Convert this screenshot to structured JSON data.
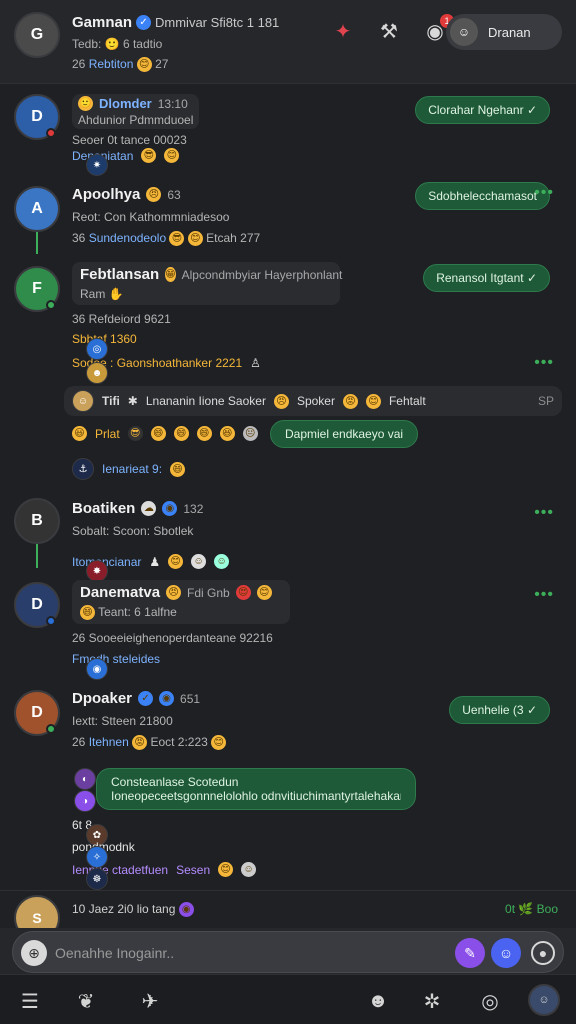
{
  "header": {
    "title": "Gamnan",
    "title_tail": "Dmmivar Sfi8tc 1 181",
    "sub": "Tedb: 🙂 6 tadtio",
    "line3_num": "26",
    "line3_link": "Rebtiton",
    "line3_tail": "27",
    "icons": [
      "fire-icon",
      "hammer-icon",
      "chat-icon"
    ],
    "badge": "1",
    "profile_label": "Dranan",
    "avatar_initials": "G"
  },
  "posts": [
    {
      "name": "Dlomder",
      "meta": "13:10",
      "line1": "Ahdunior Pdmmduoel",
      "line2": "Seoer 0t tance 00023",
      "reply_link": "Denaniatan",
      "pill": "Clorahar Ngehanr ✓",
      "initials": "D",
      "color": "#2c5fa8"
    },
    {
      "name": "Apoolhya",
      "meta": "63",
      "line1": "Reot: Con Kathommniadesoo",
      "line2_num": "36",
      "line2_link": "Sundenodeolo",
      "line2_tail": "Etcah 277",
      "pill": "Sdobhelecchamasot",
      "initials": "A",
      "color": "#3b76c4"
    },
    {
      "name": "Febtlansan",
      "meta": "Alpcondmbyiar Hayerphonlant",
      "line1": "Ram",
      "line2": "36 Refdeiord 9621",
      "reply1": "Sbbtaf 1360",
      "reply2": "Sodoe : Gaonshoathanker 2221",
      "pill": "Renansol Itgtant ✓",
      "initials": "F",
      "color": "#2f8c4a"
    },
    {
      "wide_name": "Tifi",
      "wide_mid": "Lnananin Iione Saoker",
      "wide_mid2": "Spoker",
      "wide_right": "Fehtalt",
      "wide_end": "SP",
      "prat": "Prlat",
      "green_bubble": "Dapmiel endkaeyo vai",
      "reply_link": "Ienarieat 9:"
    },
    {
      "name": "Boatiken",
      "meta": "132",
      "line1": "Sobalt: Scoon: Sbotlek",
      "reply_link": "Itomoncianar",
      "initials": "B",
      "color": "#444"
    },
    {
      "name": "Danematva",
      "meta": "Fdi Gnb",
      "line1": "Teant: 6 1alfne",
      "line2": "26 Sooeeieighenoperdanteane 92216",
      "reply_link": "Fmodh steleides",
      "initials": "D",
      "color": "#2a3e6b"
    },
    {
      "name": "Dpoaker",
      "meta": "651",
      "line1": "Iextt: Stteen 21800",
      "line2_num": "26",
      "line2_link": "Itehnen",
      "line2_tail": "Eoct 2:223",
      "pill": "Uenhelie (3 ✓",
      "bubble_l1": "Consteanlase Scotedun",
      "bubble_l2": "Ioneopeceetsgonnnelolohlo odnvitiuchimantyrtalehakan",
      "r1": "6t 8",
      "r2": "pondmodnk",
      "r3": "Iennue ctadetfuen",
      "r3b": "Sesen",
      "initials": "D",
      "color": "#a0522d"
    }
  ],
  "preview": {
    "text": "10 Jaez 2i0 lio tang",
    "right": "0t 🌿 Boo",
    "initials": "S"
  },
  "composer": {
    "placeholder": "Oenahhe Inogainr.."
  },
  "bottom_nav": [
    "menu-icon",
    "leaf-icon",
    "bird-icon",
    "bot-icon",
    "compass-icon",
    "circle-icon",
    "profile-avatar"
  ]
}
